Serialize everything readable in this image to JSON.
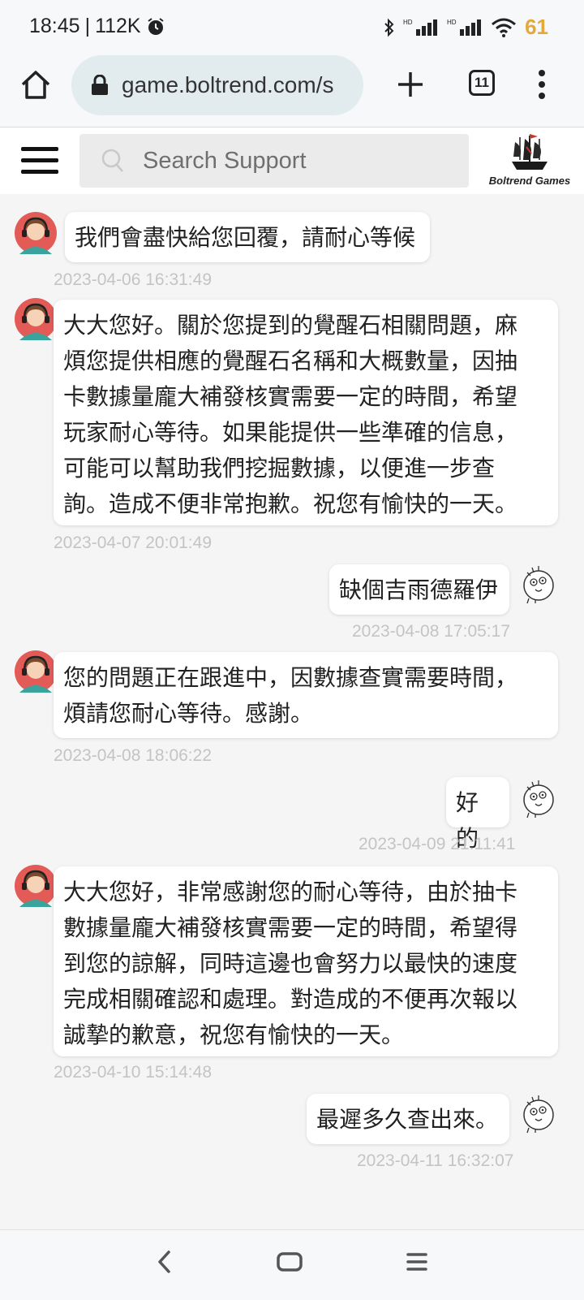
{
  "status_bar": {
    "time": "18:45",
    "separator": "|",
    "speed": "112K",
    "battery": "61",
    "battery_color": "#e5a83a",
    "icons": [
      "alarm-icon",
      "bluetooth-icon",
      "signal-hd-icon",
      "signal-hd-icon",
      "wifi-icon"
    ]
  },
  "browser": {
    "url": "game.boltrend.com/s",
    "tab_count": "11",
    "icons": [
      "home-icon",
      "lock-icon",
      "plus-icon",
      "more-vert-icon"
    ]
  },
  "support_header": {
    "search_placeholder": "Search Support",
    "logo_text": "Boltrend Games",
    "icons": [
      "hamburger-menu-icon",
      "search-icon",
      "ship-logo-icon"
    ]
  },
  "messages": [
    {
      "from": "agent",
      "lines": [
        "我們會盡快給您回覆，請耐心等候"
      ],
      "time": "2023-04-06 16:31:49"
    },
    {
      "from": "agent",
      "lines": [
        "大大您好。關於您提到的覺醒石相關問題，麻",
        "煩您提供相應的覺醒石名稱和大概數量，因抽",
        "卡數據量龐大補發核實需要一定的時間，希望",
        "玩家耐心等待。如果能提供一些準確的信息，",
        "可能可以幫助我們挖掘數據，以便進一步查",
        "詢。造成不便非常抱歉。祝您有愉快的一天。"
      ],
      "time": "2023-04-07 20:01:49"
    },
    {
      "from": "user",
      "lines": [
        "缺個吉雨德羅伊"
      ],
      "time": "2023-04-08 17:05:17"
    },
    {
      "from": "agent",
      "lines": [
        "您的問題正在跟進中，因數據查實需要時間，",
        "煩請您耐心等待。感謝。"
      ],
      "time": "2023-04-08 18:06:22"
    },
    {
      "from": "user",
      "lines": [
        "好的"
      ],
      "time": "2023-04-09 21:11:41"
    },
    {
      "from": "agent",
      "lines": [
        "大大您好，非常感謝您的耐心等待，由於抽卡",
        "數據量龐大補發核實需要一定的時間，希望得",
        "到您的諒解，同時這邊也會努力以最快的速度",
        "完成相關確認和處理。對造成的不便再次報以",
        "誠摯的歉意，祝您有愉快的一天。"
      ],
      "time": "2023-04-10 15:14:48"
    },
    {
      "from": "user",
      "lines": [
        "最遲多久查出來。"
      ],
      "time": "2023-04-11 16:32:07"
    }
  ],
  "bottom_nav": {
    "icons": [
      "back-icon",
      "home-square-icon",
      "recents-icon"
    ]
  }
}
